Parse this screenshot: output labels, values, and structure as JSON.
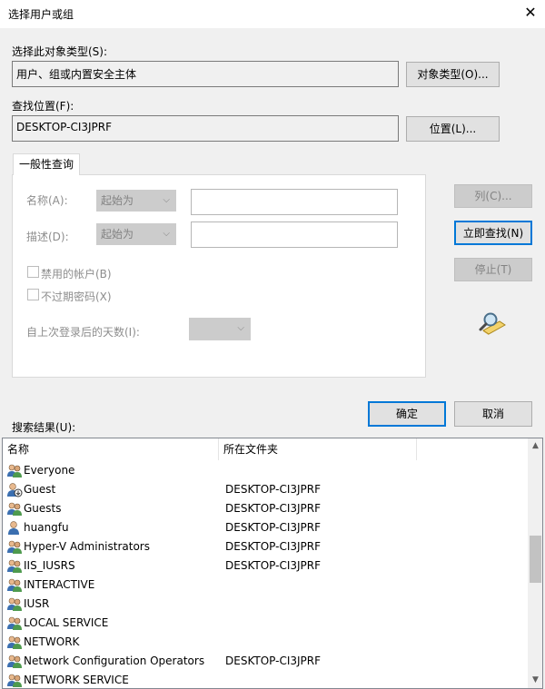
{
  "window": {
    "title": "选择用户或组",
    "close_icon": "close-icon"
  },
  "object_type": {
    "label": "选择此对象类型(S):",
    "value": "用户、组或内置安全主体",
    "button": "对象类型(O)..."
  },
  "location": {
    "label": "查找位置(F):",
    "value": "DESKTOP-CI3JPRF",
    "button": "位置(L)..."
  },
  "general_query": {
    "tab_label": "一般性查询",
    "name_label": "名称(A):",
    "name_combo": "起始为",
    "desc_label": "描述(D):",
    "desc_combo": "起始为",
    "disabled_accounts": "禁用的帐户(B)",
    "non_expiring_pw": "不过期密码(X)",
    "days_since_login": "自上次登录后的天数(I):"
  },
  "side_buttons": {
    "columns": "列(C)...",
    "find_now": "立即查找(N)",
    "stop": "停止(T)"
  },
  "dialog_buttons": {
    "ok": "确定",
    "cancel": "取消"
  },
  "results": {
    "label": "搜索结果(U):",
    "columns": [
      "名称",
      "所在文件夹"
    ],
    "rows": [
      {
        "name": "Everyone",
        "folder": "",
        "icon": "group-icon"
      },
      {
        "name": "Guest",
        "folder": "DESKTOP-CI3JPRF",
        "icon": "disabled-user-icon"
      },
      {
        "name": "Guests",
        "folder": "DESKTOP-CI3JPRF",
        "icon": "group-icon"
      },
      {
        "name": "huangfu",
        "folder": "DESKTOP-CI3JPRF",
        "icon": "user-icon"
      },
      {
        "name": "Hyper-V Administrators",
        "folder": "DESKTOP-CI3JPRF",
        "icon": "group-icon"
      },
      {
        "name": "IIS_IUSRS",
        "folder": "DESKTOP-CI3JPRF",
        "icon": "group-icon"
      },
      {
        "name": "INTERACTIVE",
        "folder": "",
        "icon": "group-icon"
      },
      {
        "name": "IUSR",
        "folder": "",
        "icon": "group-icon"
      },
      {
        "name": "LOCAL SERVICE",
        "folder": "",
        "icon": "group-icon"
      },
      {
        "name": "NETWORK",
        "folder": "",
        "icon": "group-icon"
      },
      {
        "name": "Network Configuration Operators",
        "folder": "DESKTOP-CI3JPRF",
        "icon": "group-icon"
      },
      {
        "name": "NETWORK SERVICE",
        "folder": "",
        "icon": "group-icon"
      }
    ]
  },
  "colors": {
    "accent": "#0078d7",
    "disabled_text": "#838383",
    "background": "#f0f0f0"
  }
}
